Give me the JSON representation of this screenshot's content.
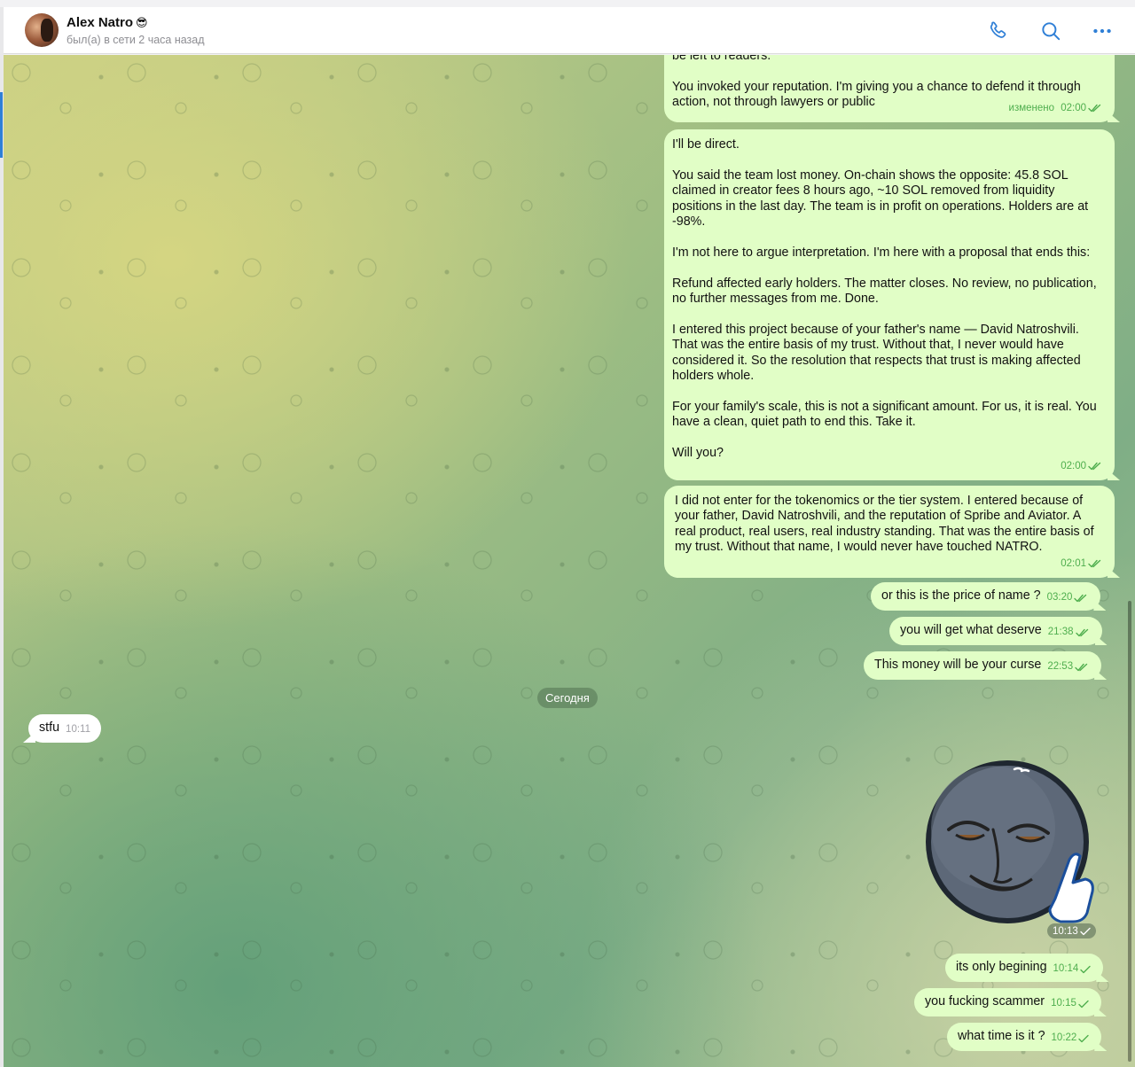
{
  "header": {
    "contact_name": "Alex Natro",
    "contact_emoji": "😎",
    "status": "был(а) в сети 2 часа назад",
    "actions": [
      "phone-icon",
      "search-icon",
      "more-icon"
    ]
  },
  "colors": {
    "outgoing_bubble": "#e1fec6",
    "incoming_bubble": "#ffffff",
    "meta_green": "#4fae4e",
    "accent_blue": "#2f7fd6"
  },
  "messages": [
    {
      "direction": "out",
      "paragraphs": [
        "be left to readers.",
        "You invoked your reputation. I'm giving you a chance to defend it through action, not through lawyers or public"
      ],
      "edited_label": "изменено",
      "time": "02:00",
      "status": "read"
    },
    {
      "direction": "out",
      "paragraphs": [
        "I'll be direct.",
        "You said the team lost money. On-chain shows the opposite: 45.8 SOL claimed in creator fees 8 hours ago, ~10 SOL removed from liquidity positions in the last day. The team is in profit on operations. Holders are at -98%.",
        "I'm not here to argue interpretation. I'm here with a proposal that ends this:",
        "Refund affected early holders. The matter closes. No review, no publication, no further messages from me. Done.",
        "I entered this project because of your father's name — David Natroshvili. That was the entire basis of my trust. Without that, I never would have considered it. So the resolution that respects that trust is making affected holders whole.",
        "For your family's scale, this is not a significant amount. For us, it is real. You have a clean, quiet path to end this. Take it.",
        "Will you?"
      ],
      "time": "02:00",
      "status": "read"
    },
    {
      "direction": "out",
      "paragraphs": [
        "I did not enter for the tokenomics or the tier system. I entered because of your father, David Natroshvili, and the reputation of Spribe and Aviator. A real product, real users, real industry standing. That was the entire basis of my trust. Without that name, I would never have touched NATRO."
      ],
      "time": "02:01",
      "status": "read"
    },
    {
      "direction": "out",
      "text": "or this is the price of name ?",
      "time": "03:20",
      "status": "read"
    },
    {
      "direction": "out",
      "text": "you will get what deserve",
      "time": "21:38",
      "status": "read"
    },
    {
      "direction": "out",
      "text": "This money will be your curse",
      "time": "22:53",
      "status": "read"
    },
    {
      "direction": "in",
      "text": "stfu",
      "time": "10:11"
    },
    {
      "direction": "out",
      "type": "sticker",
      "sticker": "moon-face-pointing-sticker",
      "time": "10:13",
      "status": "sent"
    },
    {
      "direction": "out",
      "text": "its only begining",
      "time": "10:14",
      "status": "sent"
    },
    {
      "direction": "out",
      "text": "you fucking scammer",
      "time": "10:15",
      "status": "sent"
    },
    {
      "direction": "out",
      "text": "what time is it ?",
      "time": "10:22",
      "status": "sent"
    }
  ],
  "date_separator": "Сегодня"
}
